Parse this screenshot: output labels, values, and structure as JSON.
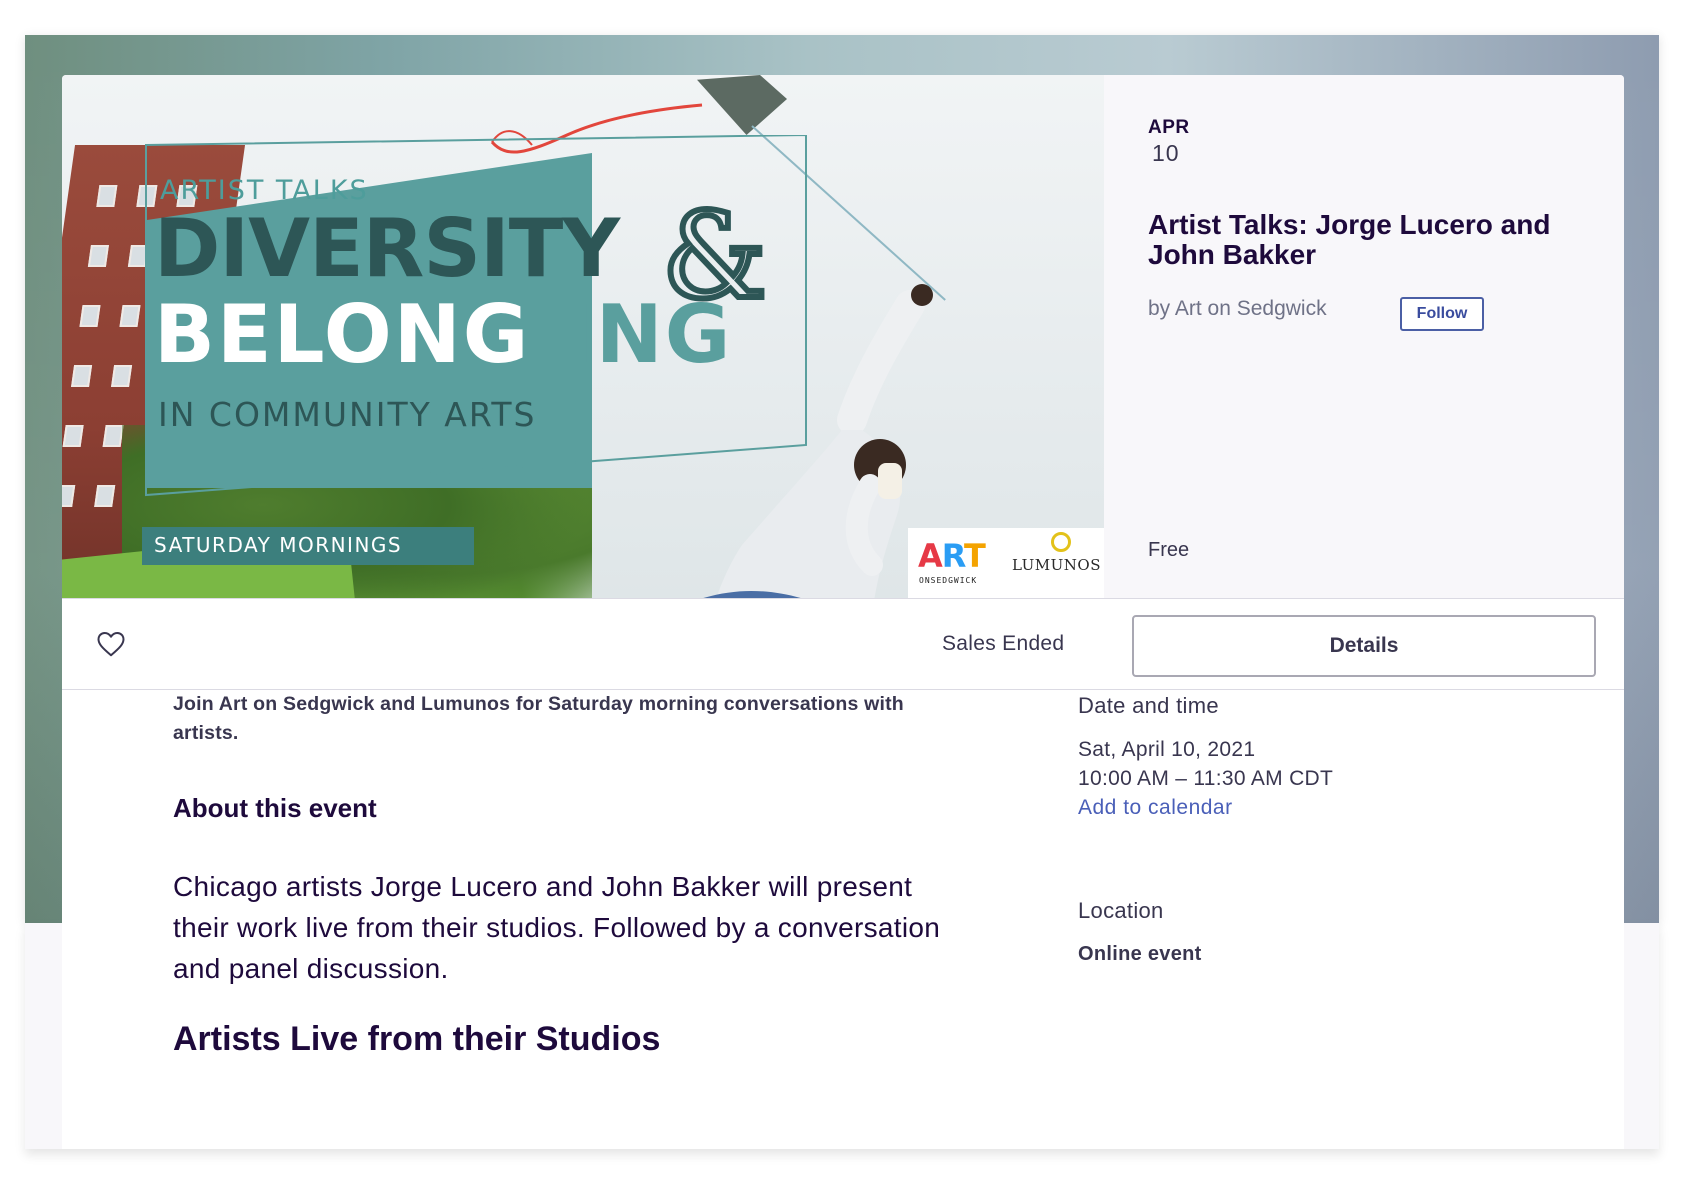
{
  "hero": {
    "artist_talks": "ARTIST TALKS",
    "diversity": "DIVERSITY",
    "ampersand": "&",
    "belong": "BELONG",
    "ing": "ING",
    "in_community_arts": "IN COMMUNITY ARTS",
    "saturday_mornings": "SATURDAY MORNINGS",
    "logo_art": "ART",
    "logo_art_sub": "ONSEDGWICK",
    "logo_lumunos": "LUMUNOS"
  },
  "event": {
    "month": "APR",
    "day": "10",
    "title": "Artist Talks: Jorge Lucero and John Bakker",
    "organizer": "by Art on Sedgwick",
    "follow_label": "Follow",
    "price": "Free"
  },
  "actions": {
    "favorite_icon": "heart-icon",
    "sales_status": "Sales Ended",
    "details_label": "Details"
  },
  "body": {
    "summary": "Join Art on Sedgwick and Lumunos for Saturday morning conversations with artists.",
    "about_heading": "About this event",
    "description": "Chicago artists Jorge Lucero and John Bakker will present their work live from their studios. Followed by a conversation and panel discussion.",
    "studios_heading": "Artists Live from their Studios"
  },
  "sidebar": {
    "date_heading": "Date and time",
    "date": "Sat, April 10, 2021",
    "time": "10:00 AM – 11:30 AM CDT",
    "add_to_calendar": "Add to calendar",
    "location_heading": "Location",
    "location": "Online event"
  },
  "colors": {
    "teal": "#5a9f9e",
    "dark_teal": "#2d5656",
    "link": "#4a5fb8",
    "ink": "#1e0a3c"
  }
}
